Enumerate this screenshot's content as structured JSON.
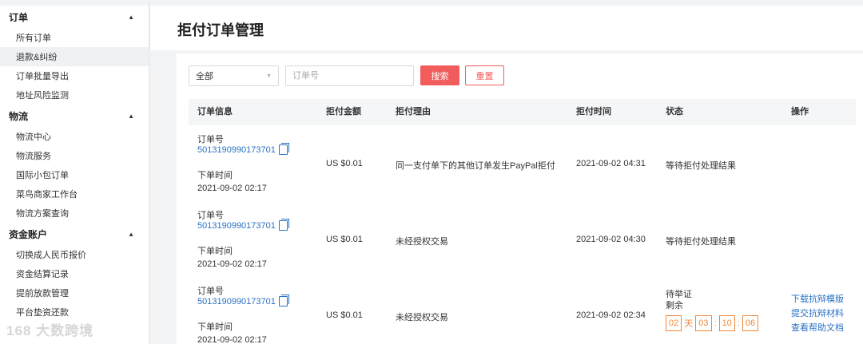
{
  "sidebar": {
    "groups": [
      {
        "title": "订单",
        "items": [
          "所有订单",
          "退款&纠纷",
          "订单批量导出",
          "地址风险监测"
        ]
      },
      {
        "title": "物流",
        "items": [
          "物流中心",
          "物流服务",
          "国际小包订单",
          "菜鸟商家工作台",
          "物流方案查询"
        ]
      },
      {
        "title": "资金账户",
        "items": [
          "切换成人民币报价",
          "资金结算记录",
          "提前放款管理",
          "平台垫资还款"
        ]
      }
    ]
  },
  "page": {
    "title": "拒付订单管理"
  },
  "filter": {
    "select_value": "全部",
    "order_placeholder": "订单号",
    "search_label": "搜索",
    "reset_label": "重置"
  },
  "table": {
    "headers": [
      "订单信息",
      "拒付金额",
      "拒付理由",
      "拒付时间",
      "状态",
      "操作"
    ],
    "order_label": "订单号",
    "time_label": "下单时间",
    "rows": [
      {
        "order_id": "5013190990173701",
        "order_time": "2021-09-02 02:17",
        "amount": "US $0.01",
        "reason": "同一支付单下的其他订单发生PayPal拒付",
        "refusal_time": "2021-09-02 04:31",
        "status": "等待拒付处理结果"
      },
      {
        "order_id": "5013190990173701",
        "order_time": "2021-09-02 02:17",
        "amount": "US $0.01",
        "reason": "未经授权交易",
        "refusal_time": "2021-09-02 04:30",
        "status": "等待拒付处理结果"
      },
      {
        "order_id": "5013190990173701",
        "order_time": "2021-09-02 02:17",
        "amount": "US $0.01",
        "reason": "未经授权交易",
        "refusal_time": "2021-09-02 02:34",
        "status": "待举证",
        "status_sub": "剩余",
        "countdown": {
          "days": "02",
          "day_unit": "天",
          "hours": "03",
          "minutes": "10",
          "seconds": "06",
          "sep": ":"
        },
        "actions": [
          "下载抗辩模版",
          "提交抗辩材料",
          "查看帮助文档"
        ]
      }
    ]
  },
  "watermark": "168 大数跨境",
  "colors": {
    "accent": "#f25c5c",
    "link": "#2a72c4",
    "countdown": "#f0883a"
  },
  "icons": {
    "copy": "copy-icon",
    "caret": "caret-up-icon",
    "dropdown": "chevron-down-icon"
  }
}
